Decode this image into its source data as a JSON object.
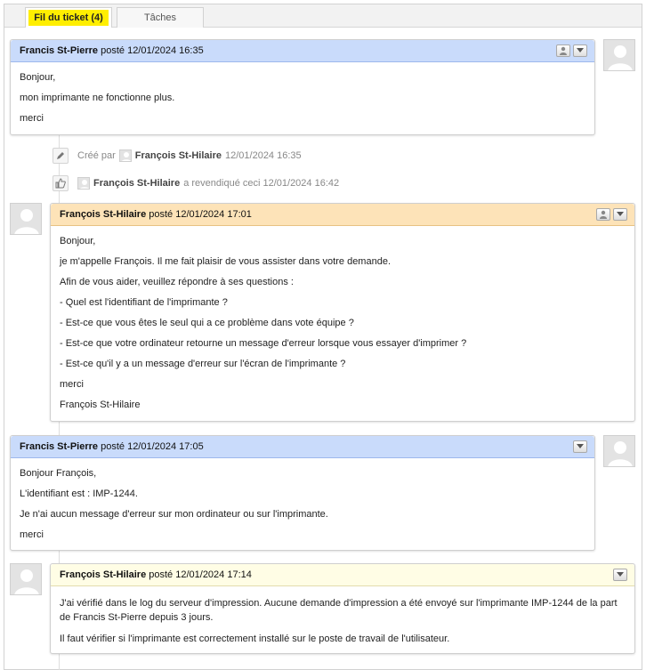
{
  "tabs": [
    {
      "label": "Fil du ticket (4)",
      "active": true
    },
    {
      "label": "Tâches",
      "active": false
    }
  ],
  "messages": [
    {
      "author": "Francis St-Pierre",
      "meta": "posté 12/01/2024 16:35",
      "lines": [
        "Bonjour,",
        "mon imprimante ne fonctionne plus.",
        "merci"
      ]
    },
    {
      "author": "François St-Hilaire",
      "meta": "posté 12/01/2024 17:01",
      "lines": [
        "Bonjour,",
        "je m'appelle François. Il me fait plaisir de vous assister dans votre demande.",
        "Afin de vous aider, veuillez répondre à ses questions :",
        "- Quel est l'identifiant de l'imprimante ?",
        "- Est-ce que vous êtes le seul qui a ce problème dans vote équipe ?",
        "- Est-ce que votre ordinateur retourne un message d'erreur lorsque vous essayer d'imprimer ?",
        "- Est-ce qu'il y a un message d'erreur sur l'écran de l'imprimante ?",
        "merci",
        "François St-Hilaire"
      ]
    },
    {
      "author": "Francis St-Pierre",
      "meta": "posté 12/01/2024 17:05",
      "lines": [
        "Bonjour François,",
        "L'identifiant est : IMP-1244.",
        "Je n'ai aucun message d'erreur sur mon ordinateur ou sur l'imprimante.",
        "merci"
      ]
    },
    {
      "author": "François St-Hilaire",
      "meta": "posté 12/01/2024 17:14",
      "lines": [
        "J'ai vérifié dans le log du serveur d'impression. Aucune demande d'impression a été envoyé sur l'imprimante IMP-1244 de la part de Francis St-Pierre depuis 3 jours.",
        "Il faut vérifier si l'imprimante est correctement installé sur le poste de travail de l'utilisateur."
      ]
    }
  ],
  "events": [
    {
      "prefix": "Créé par",
      "name": "François St-Hilaire",
      "suffix": "12/01/2024 16:35",
      "icon": "pencil-icon"
    },
    {
      "prefix": "",
      "name": "François St-Hilaire",
      "suffix": "a revendiqué ceci 12/01/2024 16:42",
      "icon": "thumbs-up-icon"
    }
  ],
  "colors": {
    "requester_header": "#c9dbfb",
    "technician_header": "#fde3b8",
    "private_header": "#fffde5",
    "active_tab_highlight": "#ffee00"
  }
}
